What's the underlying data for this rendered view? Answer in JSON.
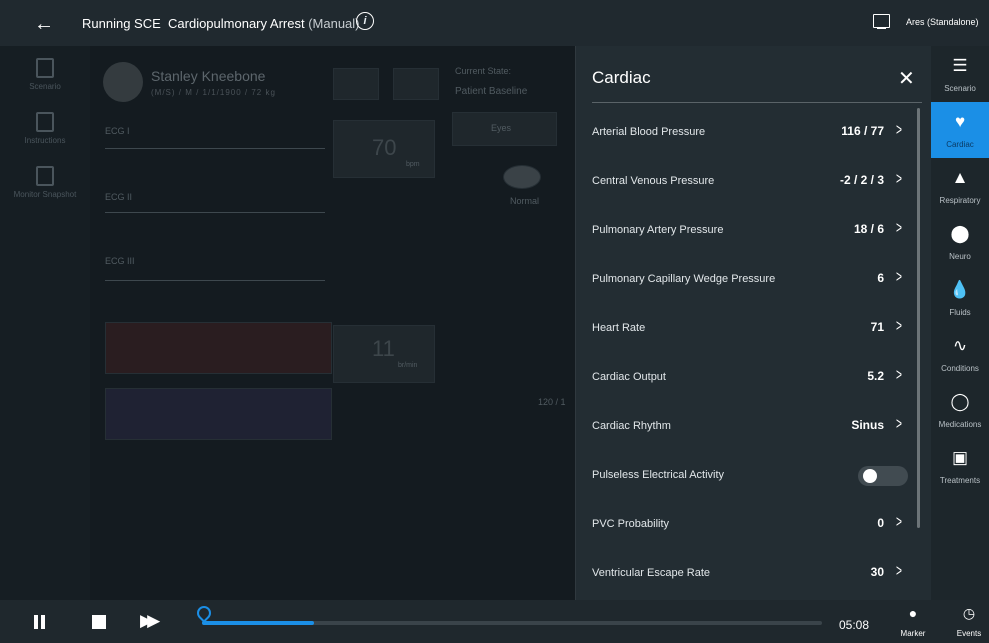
{
  "topbar": {
    "back_icon": "arrow-left-icon",
    "status": "Running SCE",
    "scenario": "Cardiopulmonary Arrest",
    "mode": "(Manual)",
    "instructor": "Ares (Standalone)"
  },
  "background": {
    "patient_name": "Stanley Kneebone",
    "patient_demo": "(M/S) / M / 1/1/1900 / 72 kg",
    "current_state_label": "Current State:",
    "current_state_value": "Patient Baseline",
    "eyes_button": "Eyes",
    "eye_state": "Normal",
    "hr_value": "70",
    "hr_unit": "bpm",
    "rr_value": "11",
    "rr_unit": "br/min",
    "bp_value": "120 / 1",
    "lead1": "ECG I",
    "lead2": "ECG II",
    "lead3": "ECG III",
    "sidebar": [
      "Scenario",
      "Instructions",
      "Monitor Snapshot"
    ]
  },
  "panel": {
    "title": "Cardiac",
    "rows": [
      {
        "label": "Arterial Blood Pressure",
        "value": "116 / 77"
      },
      {
        "label": "Central Venous Pressure",
        "value": "-2 / 2 / 3"
      },
      {
        "label": "Pulmonary Artery Pressure",
        "value": "18 / 6"
      },
      {
        "label": "Pulmonary Capillary Wedge Pressure",
        "value": "6"
      },
      {
        "label": "Heart Rate",
        "value": "71"
      },
      {
        "label": "Cardiac Output",
        "value": "5.2"
      },
      {
        "label": "Cardiac Rhythm",
        "value": "Sinus"
      },
      {
        "label": "Pulseless Electrical Activity",
        "value": "",
        "toggle": false
      },
      {
        "label": "PVC Probability",
        "value": "0"
      },
      {
        "label": "Ventricular Escape Rate",
        "value": "30"
      }
    ]
  },
  "rail": {
    "tabs": [
      {
        "label": "Scenario",
        "icon": "list-icon"
      },
      {
        "label": "Cardiac",
        "icon": "heart-icon",
        "active": true
      },
      {
        "label": "Respiratory",
        "icon": "lungs-icon"
      },
      {
        "label": "Neuro",
        "icon": "brain-icon"
      },
      {
        "label": "Fluids",
        "icon": "droplet-icon"
      },
      {
        "label": "Conditions",
        "icon": "pulse-icon"
      },
      {
        "label": "Medications",
        "icon": "pill-icon"
      },
      {
        "label": "Treatments",
        "icon": "medkit-icon"
      }
    ]
  },
  "bottombar": {
    "time": "05:08",
    "progress": 0.18,
    "marker_label": "Marker",
    "events_label": "Events"
  },
  "colors": {
    "accent": "#1b8fe6",
    "panel_bg": "#232d33",
    "topbar_bg": "#20292f"
  }
}
